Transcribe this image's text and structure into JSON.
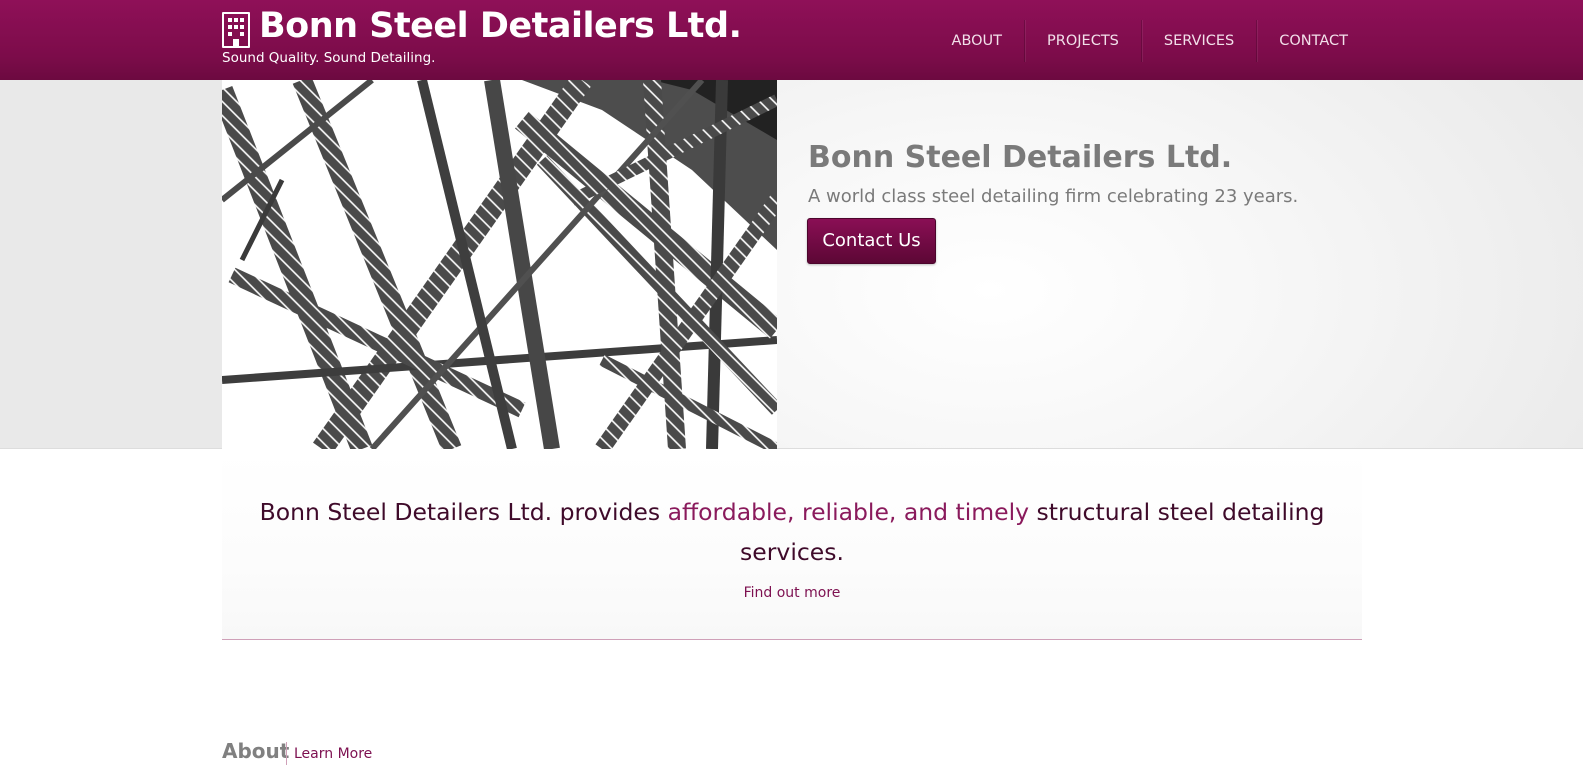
{
  "header": {
    "brand_icon": "building-icon",
    "title": "Bonn Steel Detailers Ltd.",
    "tagline": "Sound Quality. Sound Detailing.",
    "nav": [
      {
        "label": "ABOUT"
      },
      {
        "label": "PROJECTS"
      },
      {
        "label": "SERVICES"
      },
      {
        "label": "CONTACT"
      }
    ],
    "colors": {
      "brand": "#7c0c4a",
      "nav_text": "#f2e0ea"
    }
  },
  "hero": {
    "image": "steel-truss-bridge-photo",
    "title": "Bonn Steel Detailers Ltd.",
    "subtitle": "A world class steel detailing firm celebrating 23 years.",
    "button_label": "Contact Us"
  },
  "intro": {
    "text_before": "Bonn Steel Detailers Ltd. provides ",
    "text_accent": "affordable, reliable, and timely",
    "text_after": " structural steel detailing services.",
    "link_label": "Find out more",
    "colors": {
      "text": "#3f0a2a",
      "accent": "#8a1a5c"
    }
  },
  "about": {
    "heading": "About",
    "link_label": "Learn More"
  }
}
